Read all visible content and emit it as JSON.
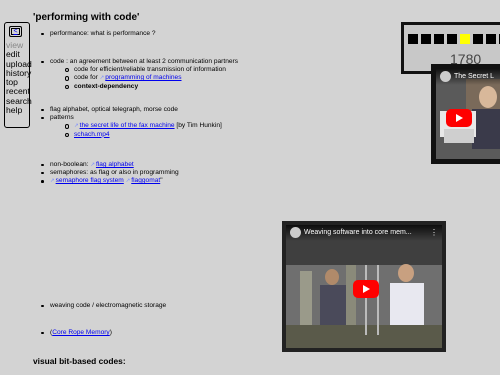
{
  "sidebar": {
    "back_label": "<",
    "items": [
      "view",
      "edit",
      "upload",
      "history",
      "top",
      "recent",
      "search",
      "help"
    ]
  },
  "page": {
    "title": "'performing with code'"
  },
  "sections": {
    "performance": "performance: what is performance ?",
    "code": {
      "text": "code : an agreement between at least 2 communication partners",
      "sub1": "code for efficient/reliable transmission of information",
      "sub2_prefix": "code for ",
      "sub2_link": "programming of machines",
      "sub3": "context-dependency"
    },
    "flag": {
      "text": "flag alphabet, optical telegraph, morse code",
      "patterns": "patterns",
      "link1": "the secret life of the fax machine",
      "link1_suffix": " [by Tim Hunkin]",
      "link2": "schach.mp4"
    },
    "nonboolean": {
      "text_prefix": "non-boolean: ",
      "link": "flag alphabet",
      "semaphores": "semaphores: as flag or also in programming",
      "link2": "semaphore flag system",
      "link3": "flaggomat",
      "quote": "\""
    },
    "weaving": "weaving code / electromagnetic storage",
    "core_rope": {
      "open": "(",
      "link": "Core Rope Memory",
      "close": ")"
    }
  },
  "bottom_heading": "visual bit-based codes:",
  "counter": {
    "value": "1780",
    "squares": [
      false,
      false,
      false,
      false,
      true,
      false,
      false,
      false
    ]
  },
  "video1": {
    "title": "The Secret L"
  },
  "video2": {
    "title": "Weaving software into core mem..."
  },
  "icons": {
    "external_link": "↗",
    "play": "play-icon",
    "more": "⋮"
  }
}
